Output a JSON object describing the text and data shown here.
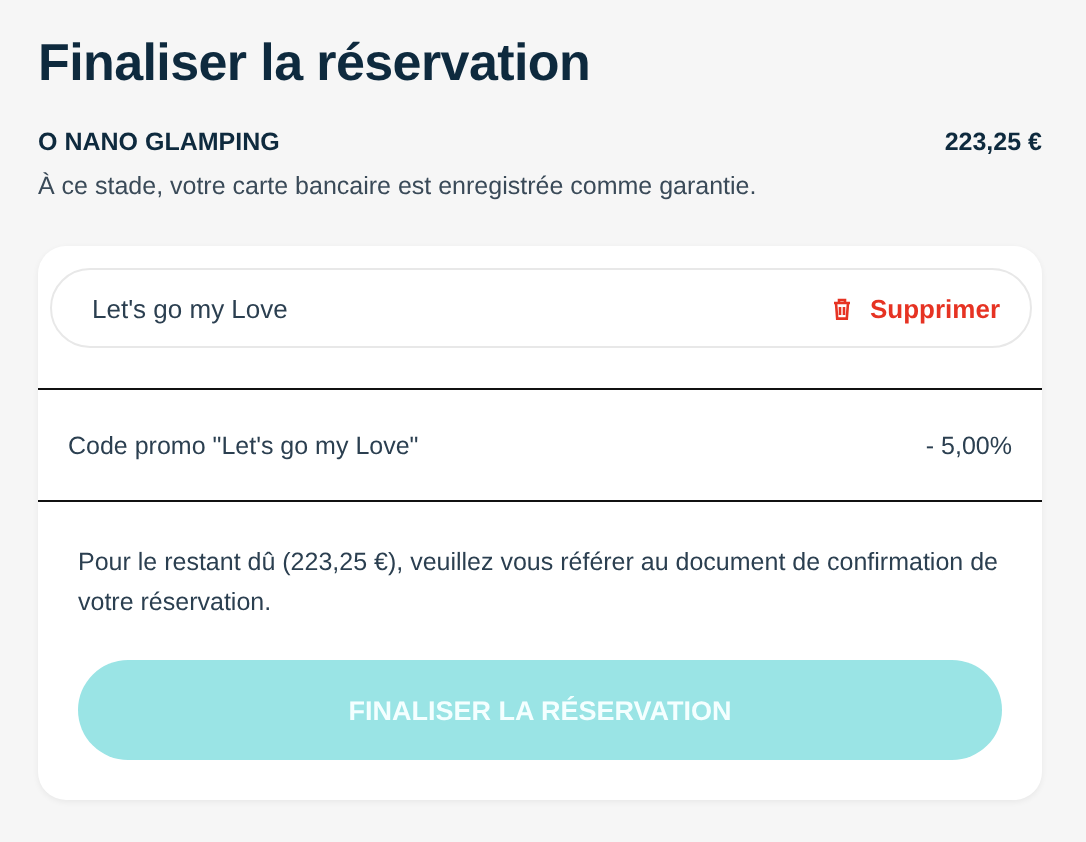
{
  "title": "Finaliser la réservation",
  "summary": {
    "name": "O NANO GLAMPING",
    "price": "223,25 €",
    "note": "À ce stade, votre carte bancaire est enregistrée comme garantie."
  },
  "coupon": {
    "code": "Let's go my Love",
    "remove_label": "Supprimer"
  },
  "discount": {
    "label": "Code promo \"Let's go my Love\"",
    "value": "- 5,00%"
  },
  "info": "Pour le restant dû (223,25 €), veuillez vous référer au document de confirmation de votre réservation.",
  "submit": {
    "label": "FINALISER LA RÉSERVATION",
    "disabled": true
  }
}
